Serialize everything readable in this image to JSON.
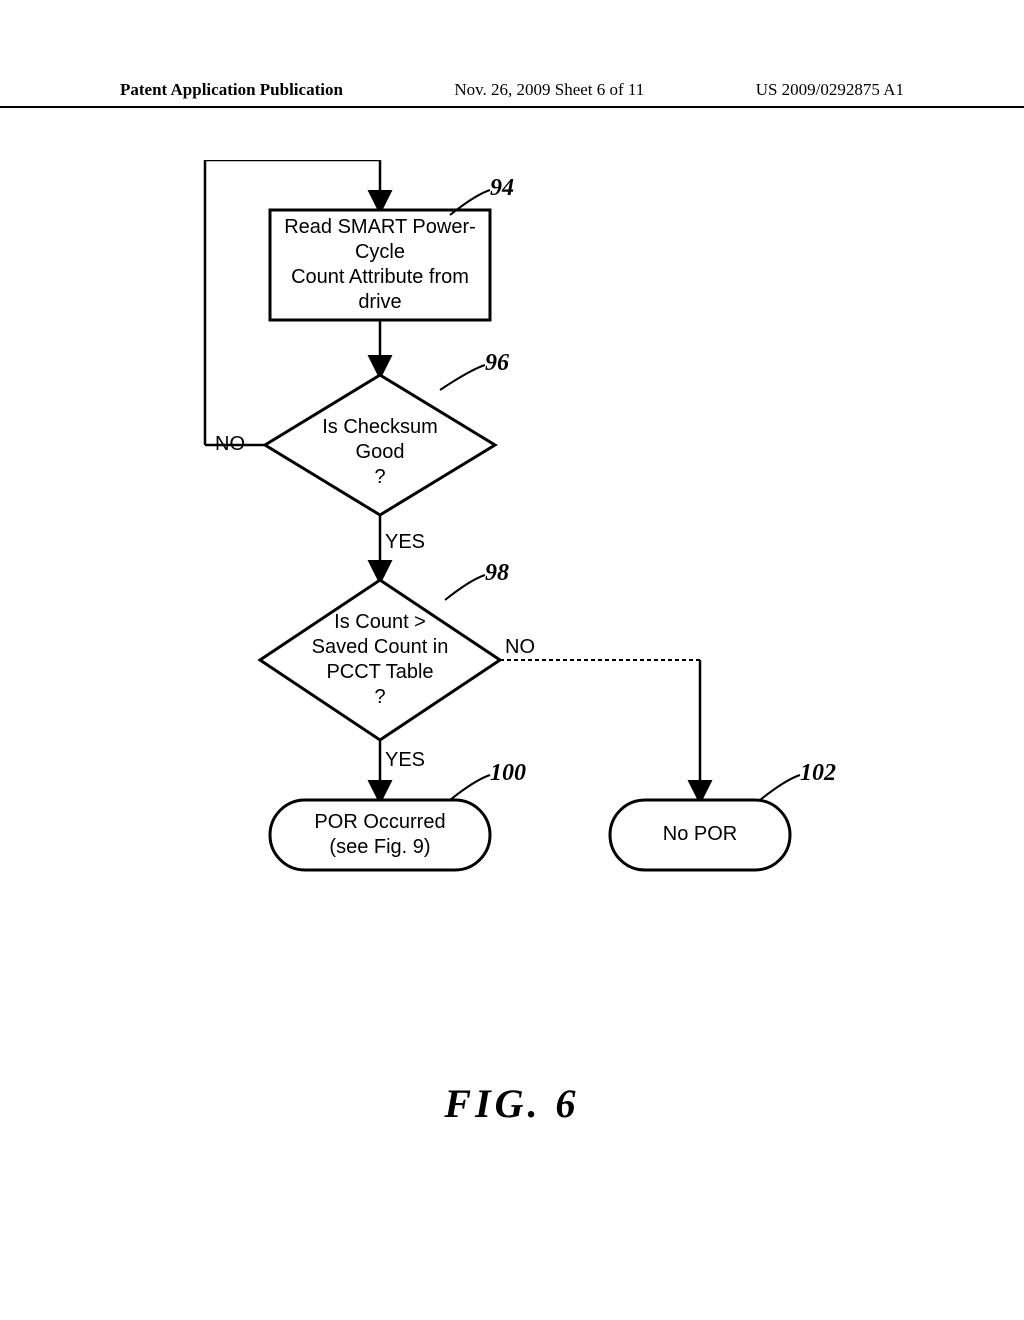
{
  "header": {
    "left": "Patent Application Publication",
    "center": "Nov. 26, 2009  Sheet 6 of 11",
    "right": "US 2009/0292875 A1"
  },
  "flow": {
    "box94": "Read SMART Power-\nCycle\nCount Attribute from\ndrive",
    "dec96": "Is Checksum\nGood\n?",
    "dec98": "Is Count >\nSaved Count in\nPCCT Table\n?",
    "term100": "POR Occurred\n(see Fig. 9)",
    "term102": "No POR",
    "yes": "YES",
    "no": "NO"
  },
  "refs": {
    "r94": "94",
    "r96": "96",
    "r98": "98",
    "r100": "100",
    "r102": "102"
  },
  "figure_caption": "FIG.  6"
}
